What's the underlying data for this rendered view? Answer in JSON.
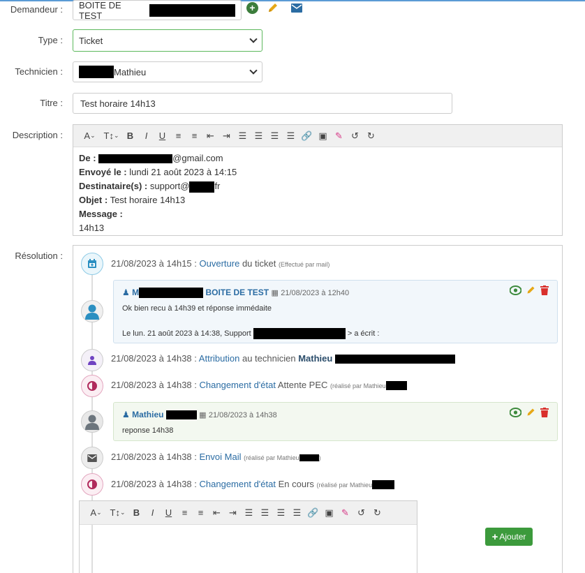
{
  "form": {
    "requester_label": "Demandeur :",
    "requester_value": "BOITE DE TEST",
    "type_label": "Type :",
    "type_value": "Ticket",
    "technician_label": "Technicien :",
    "technician_value": "Mathieu",
    "title_label": "Titre :",
    "title_value": "Test horaire 14h13",
    "description_label": "Description :",
    "resolution_label": "Résolution :"
  },
  "description": {
    "from_label": "De :",
    "from_value": "@gmail.com",
    "sent_label": "Envoyé le :",
    "sent_value": "lundi 21 août 2023 à 14:15",
    "to_label": "Destinataire(s) :",
    "to_value_a": "support@",
    "to_value_b": "fr",
    "subject_label": "Objet :",
    "subject_value": "Test horaire 14h13",
    "message_label": "Message :",
    "message_value": "14h13"
  },
  "timeline": {
    "e1_date": "21/08/2023 à 14h15 :",
    "e1_link": "Ouverture",
    "e1_text": "du ticket",
    "e1_small": "(Effectué par mail)",
    "c1_author_a": "M",
    "c1_author_b": "BOITE DE TEST",
    "c1_date": "21/08/2023 à 12h40",
    "c1_line1": "Ok bien recu à 14h39 et réponse immédaite",
    "c1_line2a": "Le lun. 21 août 2023 à 14:38, Support",
    "c1_line2b": "> a écrit :",
    "e2_date": "21/08/2023 à 14h38 :",
    "e2_link": "Attribution",
    "e2_text": "au technicien",
    "e2_bold": "Mathieu",
    "e3_date": "21/08/2023 à 14h38 :",
    "e3_link": "Changement d'état",
    "e3_text": "Attente PEC",
    "e3_small": "(réalisé par Mathieu",
    "c2_author": "Mathieu",
    "c2_date": "21/08/2023 à 14h38",
    "c2_line1": "reponse 14h38",
    "e4_date": "21/08/2023 à 14h38 :",
    "e4_link": "Envoi Mail",
    "e4_small": "(réalisé par Mathieu",
    "e4_small_end": ")",
    "e5_date": "21/08/2023 à 14h38 :",
    "e5_link": "Changement d'état",
    "e5_text": "En cours",
    "e5_small": "(réalisé par Mathieu"
  },
  "buttons": {
    "add_label": "Ajouter"
  },
  "colors": {
    "link": "#2b6ca3",
    "green": "#3c9a3c",
    "edit": "#e6a817",
    "delete": "#d9302c",
    "card_blue_bg": "#f2f7fb",
    "card_green_bg": "#f3f8f0"
  }
}
